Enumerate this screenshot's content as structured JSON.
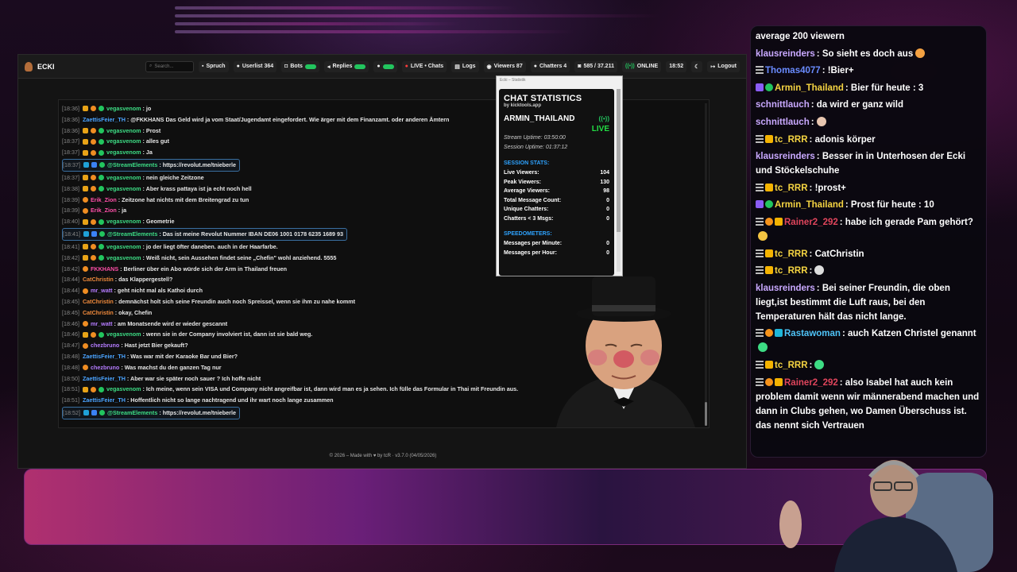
{
  "app": {
    "brand": "ECKI",
    "search_placeholder": "Search...",
    "nav": [
      {
        "label": "Spruch"
      },
      {
        "label": "Userlist 364"
      },
      {
        "label": "Bots"
      },
      {
        "label": "Replies"
      },
      {
        "label": ""
      },
      {
        "label": "LIVE • Chats"
      },
      {
        "label": "Logs"
      },
      {
        "label": "Viewers 87"
      },
      {
        "label": "Chatters 4"
      },
      {
        "label": "585 / 37.211"
      },
      {
        "label": "ONLINE"
      },
      {
        "label": "18:52"
      },
      {
        "label": ""
      },
      {
        "label": "Logout"
      }
    ],
    "footer": "© 2026 – Made with ♥ by tcR · v3.7.0 (04/05/2026)"
  },
  "chat": [
    {
      "time": "[18:36]",
      "user": "vegasvenom",
      "color": "green",
      "text": ": jo"
    },
    {
      "time": "[18:36]",
      "user": "ZaettisFeier_TH",
      "color": "blue",
      "text": ": @FKKHANS Das Geld wird ja vom Staat/Jugendamt eingefordert. Wie ärger mit dem Finanzamt. oder anderen Ämtern"
    },
    {
      "time": "[18:36]",
      "user": "vegasvenom",
      "color": "green",
      "text": ": Prost"
    },
    {
      "time": "[18:37]",
      "user": "vegasvenom",
      "color": "green",
      "text": ": alles gut"
    },
    {
      "time": "[18:37]",
      "user": "vegasvenom",
      "color": "green",
      "text": ": Ja"
    },
    {
      "time": "[18:37]",
      "user": "@StreamElements",
      "color": "green",
      "text": ": https://revolut.me/tnieberle",
      "highlight": true
    },
    {
      "time": "[18:37]",
      "user": "vegasvenom",
      "color": "green",
      "text": ": nein gleiche Zeitzone"
    },
    {
      "time": "[18:38]",
      "user": "vegasvenom",
      "color": "green",
      "text": ": Aber krass pattaya ist ja echt noch hell"
    },
    {
      "time": "[18:39]",
      "user": "Erik_Zion",
      "color": "pink",
      "text": ": Zeitzone hat nichts mit dem Breitengrad zu tun"
    },
    {
      "time": "[18:39]",
      "user": "Erik_Zion",
      "color": "pink",
      "text": ": ja"
    },
    {
      "time": "[18:40]",
      "user": "vegasvenom",
      "color": "green",
      "text": ": Geometrie"
    },
    {
      "time": "[18:41]",
      "user": "@StreamElements",
      "color": "green",
      "text": ": Das ist meine Revolut Nummer IBAN DE06 1001 0178 6235 1689 93",
      "highlight": true
    },
    {
      "time": "[18:41]",
      "user": "vegasvenom",
      "color": "green",
      "text": ": jo der liegt öfter daneben. auch in der Haarfarbe."
    },
    {
      "time": "[18:42]",
      "user": "vegasvenom",
      "color": "green",
      "text": ": Weiß nicht, sein Aussehen findet seine „Chefin\" wohl anziehend. 5555"
    },
    {
      "time": "[18:42]",
      "user": "FKKHANS",
      "color": "pink",
      "text": ": Berliner über ein Abo würde sich der Arm in Thailand freuen"
    },
    {
      "time": "[18:44]",
      "user": "CatChristin",
      "color": "orange",
      "text": ": das Klappergestell?"
    },
    {
      "time": "[18:44]",
      "user": "mr_watt",
      "color": "purple",
      "text": ": geht nicht mal als Kathoi durch"
    },
    {
      "time": "[18:45]",
      "user": "CatChristin",
      "color": "orange",
      "text": ": demnächst holt sich seine Freundin auch noch Spreissel, wenn sie ihm zu nahe kommt"
    },
    {
      "time": "[18:45]",
      "user": "CatChristin",
      "color": "orange",
      "text": ": okay, Chefin"
    },
    {
      "time": "[18:46]",
      "user": "mr_watt",
      "color": "purple",
      "text": ": am Monatsende wird er wieder gescannt"
    },
    {
      "time": "[18:46]",
      "user": "vegasvenom",
      "color": "green",
      "text": ": wenn sie in der Company involviert ist, dann ist sie bald weg."
    },
    {
      "time": "[18:47]",
      "user": "chezbruno",
      "color": "purple",
      "text": ": Hast jetzt Bier gekauft?"
    },
    {
      "time": "[18:48]",
      "user": "ZaettisFeier_TH",
      "color": "blue",
      "text": ": Was war mit der Karaoke Bar und Bier?"
    },
    {
      "time": "[18:48]",
      "user": "chezbruno",
      "color": "purple",
      "text": ": Was machst du den ganzen Tag nur"
    },
    {
      "time": "[18:50]",
      "user": "ZaettisFeier_TH",
      "color": "blue",
      "text": ": Aber war sie später noch sauer ? Ich hoffe nicht"
    },
    {
      "time": "[18:51]",
      "user": "vegasvenom",
      "color": "green",
      "text": ": Ich meine, wenn sein VISA und Company nicht angreifbar ist, dann wird man es ja sehen. Ich fülle das Formular in Thai mit Freundin aus."
    },
    {
      "time": "[18:51]",
      "user": "ZaettisFeier_TH",
      "color": "blue",
      "text": ": Hoffentlich nicht so lange nachtragend und ihr wart noch lange zusammen"
    },
    {
      "time": "[18:52]",
      "user": "@StreamElements",
      "color": "green",
      "text": ": https://revolut.me/tnieberle",
      "highlight": true
    }
  ],
  "stats": {
    "window_title": "Ecki – Statistik",
    "title": "CHAT STATISTICS",
    "by": "by kicktools.app",
    "user": "ARMIN_THAILAND",
    "live": "LIVE",
    "stream_uptime": "Stream Uptime: 03:50:00",
    "session_uptime": "Session Uptime: 01:37:12",
    "session_heading": "SESSION STATS:",
    "session": [
      {
        "label": "Live Viewers:",
        "value": "104"
      },
      {
        "label": "Peak Viewers:",
        "value": "130"
      },
      {
        "label": "Average Viewers:",
        "value": "98"
      },
      {
        "label": "Total Message Count:",
        "value": "0"
      },
      {
        "label": "Unique Chatters:",
        "value": "0"
      },
      {
        "label": "Chatters < 3 Msgs:",
        "value": "0"
      }
    ],
    "speed_heading": "SPEEDOMETERS:",
    "speed": [
      {
        "label": "Messages per Minute:",
        "value": "0"
      },
      {
        "label": "Messages per Hour:",
        "value": "0"
      }
    ]
  },
  "overlay": [
    {
      "user": "",
      "text": "average 200 viewern",
      "color": "#ffffff",
      "badges": []
    },
    {
      "user": "klausreinders",
      "text": ": So sieht es doch aus",
      "color": "#c9a9ff",
      "badges": [],
      "emote": "#f4a142"
    },
    {
      "user": "Thomas4077",
      "text": ": !Bier+",
      "color": "#6a8cff",
      "badges": [
        "lines"
      ]
    },
    {
      "user": "Armin_Thailand",
      "text": ": Bier für heute : 3",
      "color": "#f5d442",
      "badges": [
        "purple",
        "green"
      ]
    },
    {
      "user": "schnittlauch",
      "text": ": da wird er ganz wild",
      "color": "#c9a9ff",
      "badges": []
    },
    {
      "user": "schnittlauch",
      "text": ":",
      "color": "#c9a9ff",
      "badges": [],
      "emote": "#e8c6b0"
    },
    {
      "user": "tc_RRR",
      "text": ": adonis körper",
      "color": "#f5d442",
      "badges": [
        "lines",
        "crown"
      ]
    },
    {
      "user": "klausreinders",
      "text": ": Besser in in Unterhosen der Ecki und Stöckelschuhe",
      "color": "#c9a9ff",
      "badges": []
    },
    {
      "user": "tc_RRR",
      "text": ": !prost+",
      "color": "#f5d442",
      "badges": [
        "lines",
        "crown"
      ]
    },
    {
      "user": "Armin_Thailand",
      "text": ": Prost für heute : 10",
      "color": "#f5d442",
      "badges": [
        "purple",
        "green"
      ]
    },
    {
      "user": "Rainer2_292",
      "text": ": habe ich gerade Pam gehört?",
      "color": "#e0455c",
      "badges": [
        "lines",
        "orange",
        "crown"
      ],
      "emote": "#f4c542"
    },
    {
      "user": "tc_RRR",
      "text": ": CatChristin",
      "color": "#f5d442",
      "badges": [
        "lines",
        "crown"
      ]
    },
    {
      "user": "tc_RRR",
      "text": ":",
      "color": "#f5d442",
      "badges": [
        "lines",
        "crown"
      ],
      "emote": "#dddddd"
    },
    {
      "user": "klausreinders",
      "text": ": Bei seiner Freundin, die oben liegt,ist bestimmt die Luft raus, bei den Temperaturen hält das nicht lange.",
      "color": "#c9a9ff",
      "badges": []
    },
    {
      "user": "Rastawoman",
      "text": ": auch Katzen Christel genannt",
      "color": "#4fc3f7",
      "badges": [
        "lines",
        "orange",
        "blue"
      ],
      "emote": "#3ddc84"
    },
    {
      "user": "tc_RRR",
      "text": ":",
      "color": "#f5d442",
      "badges": [
        "lines",
        "crown"
      ],
      "emote": "#3ddc84"
    },
    {
      "user": "Rainer2_292",
      "text": ": also Isabel hat auch kein problem damit wenn wir männerabend machen und dann in Clubs gehen, wo Damen Überschuss ist. das nennt sich Vertrauen",
      "color": "#e0455c",
      "badges": [
        "lines",
        "orange",
        "crown"
      ]
    }
  ]
}
